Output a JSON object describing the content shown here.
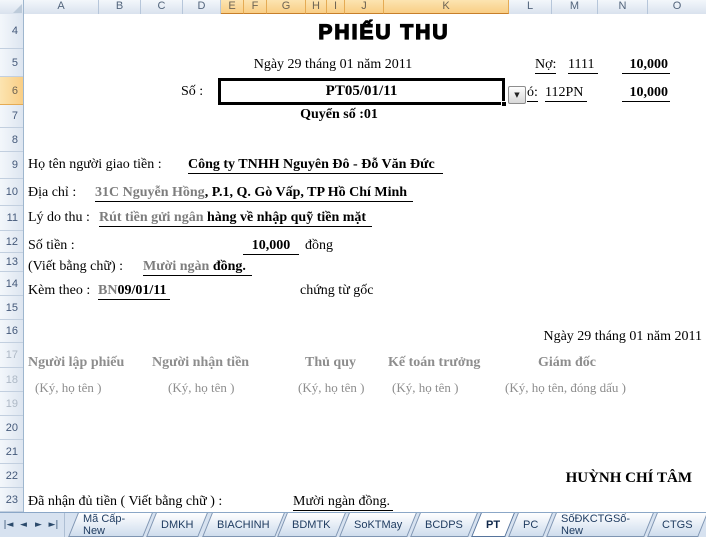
{
  "columns": {
    "labels": [
      "A",
      "B",
      "C",
      "D",
      "E",
      "F",
      "G",
      "H",
      "I",
      "J",
      "K",
      "L",
      "M",
      "N",
      "O"
    ],
    "selected": [
      "E",
      "F",
      "G",
      "H",
      "I",
      "J",
      "K"
    ]
  },
  "rows": {
    "labels": [
      "4",
      "5",
      "6",
      "7",
      "8",
      "9",
      "10",
      "11",
      "12",
      "13",
      "14",
      "15",
      "16",
      "17",
      "18",
      "19",
      "20",
      "21",
      "22",
      "23"
    ],
    "selected": "6",
    "dimmed": [
      "17",
      "18",
      "19"
    ]
  },
  "form": {
    "title": "PHIẾU  THU",
    "date_line": "Ngày 29 tháng 01 năm 2011",
    "debit_label": "Nợ:",
    "debit_account": "1111",
    "debit_amount": "10,000",
    "so_label": "Số :",
    "so_value": "PT05/01/11",
    "dropdown_icon": "▼",
    "credit_label_partial": "ó:",
    "credit_account": "112PN",
    "credit_amount": "10,000",
    "book_no": "Quyển số :01",
    "payer_label": "Họ tên người giao tiền : ",
    "payer_value": "Công ty TNHH Nguyên Đô - Đỗ Văn Đức",
    "address_label": "Địa chỉ :",
    "address_value_dim": "31C Nguyễn Hồng",
    "address_value_rest": ", P.1, Q. Gò Vấp, TP Hồ Chí Minh",
    "reason_label": "Lý do thu :",
    "reason_value_dim": "Rút tiền gửi ngân",
    "reason_value_rest": " hàng về nhập quỹ tiền mặt",
    "amount_label": "Số tiền :",
    "amount_value": "10,000",
    "amount_unit": "đồng",
    "words_label": "(Viết bằng chữ) :",
    "words_value_dim": "Mười ngàn",
    "words_value_rest": " đồng.",
    "attach_label": "Kèm theo :",
    "attach_value_dim": "BN",
    "attach_value_rest": "09/01/11",
    "attach_suffix": "chứng từ gốc",
    "date_line2": "Ngày 29 tháng 01 năm 2011",
    "signatures": [
      {
        "role": "Người lập phiếu",
        "note": "(Ký, họ tên )"
      },
      {
        "role": "Người nhận tiền",
        "note": "(Ký, họ tên )"
      },
      {
        "role": "Thủ quy",
        "note": "(Ký, họ tên )"
      },
      {
        "role": "Kế toán trưởng",
        "note": "(Ký, họ tên )"
      },
      {
        "role": "Giám đốc",
        "note": "(Ký, họ tên, đóng dấu )"
      }
    ],
    "signer_name": "HUỲNH CHÍ TÂM",
    "received_label": "Đã nhận đủ tiền ( Viết bằng chữ ) : ",
    "received_value": "Mười ngàn đồng."
  },
  "tabbar": {
    "nav_icons": [
      "|◄",
      "◄",
      "►",
      "►|"
    ],
    "tabs": [
      "Mã Cấp-New",
      "DMKH",
      "BIACHINH",
      "BDMTK",
      "SoKTMay",
      "BCDPS",
      "PT",
      "PC",
      "SốĐKCTGSố-New",
      "CTGS"
    ],
    "active_tab": "PT"
  },
  "colors": {
    "selected_header": "#f9ce85",
    "header_gradient_top": "#f3f7fb",
    "header_gradient_bottom": "#d9e2ee",
    "tabbar_background": "#d7e2f0",
    "active_tab_text": "#10284a",
    "dim_text": "#8d8d8d"
  }
}
